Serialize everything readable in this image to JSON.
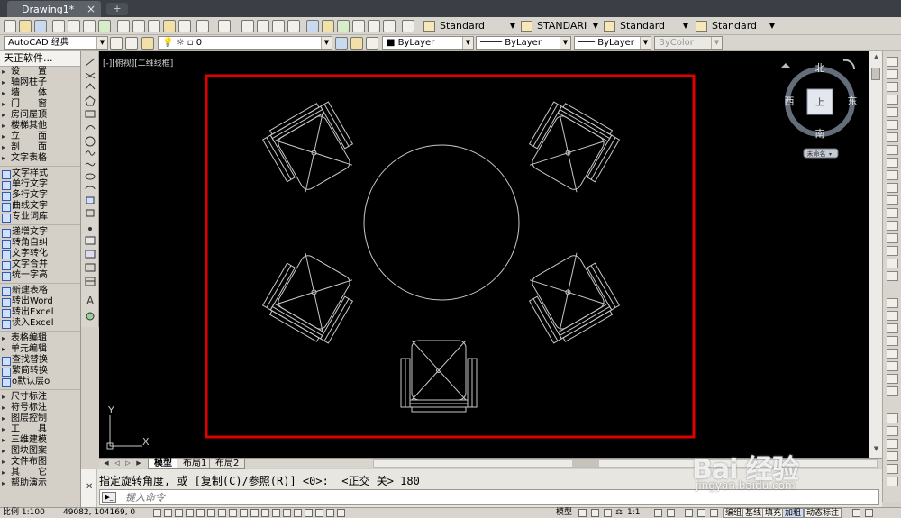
{
  "window": {
    "doc_tab": "Drawing1*",
    "new_tab_icon": "plus-icon"
  },
  "toolbar1": {
    "text_style": "Standard",
    "dim_style": "STANDARI",
    "table_style": "Standard",
    "multileader_style": "Standard"
  },
  "toolbar2": {
    "workspace": "AutoCAD 经典",
    "layer": "0",
    "color": "ByLayer",
    "linetype": "ByLayer",
    "lineweight": "ByLayer",
    "plot_style": "ByColor"
  },
  "palette": {
    "title": "天正软件...",
    "items": [
      {
        "label": "设　　置",
        "kind": "cat"
      },
      {
        "label": "轴网柱子",
        "kind": "cat"
      },
      {
        "label": "墙　　体",
        "kind": "cat"
      },
      {
        "label": "门　　窗",
        "kind": "cat"
      },
      {
        "label": "房间屋顶",
        "kind": "cat"
      },
      {
        "label": "楼梯其他",
        "kind": "cat"
      },
      {
        "label": "立　　面",
        "kind": "cat"
      },
      {
        "label": "剖　　面",
        "kind": "cat"
      },
      {
        "label": "文字表格",
        "kind": "cat"
      },
      {
        "label": "文字样式",
        "kind": "sub"
      },
      {
        "label": "单行文字",
        "kind": "sub"
      },
      {
        "label": "多行文字",
        "kind": "sub"
      },
      {
        "label": "曲线文字",
        "kind": "sub"
      },
      {
        "label": "专业词库",
        "kind": "sub"
      },
      {
        "label": "递增文字",
        "kind": "sub"
      },
      {
        "label": "转角自纠",
        "kind": "sub"
      },
      {
        "label": "文字转化",
        "kind": "sub"
      },
      {
        "label": "文字合并",
        "kind": "sub"
      },
      {
        "label": "统一字高",
        "kind": "sub"
      },
      {
        "label": "新建表格",
        "kind": "sub"
      },
      {
        "label": "转出Word",
        "kind": "sub"
      },
      {
        "label": "转出Excel",
        "kind": "sub"
      },
      {
        "label": "读入Excel",
        "kind": "sub"
      },
      {
        "label": "表格编辑",
        "kind": "cat"
      },
      {
        "label": "单元编辑",
        "kind": "cat"
      },
      {
        "label": "查找替换",
        "kind": "sub"
      },
      {
        "label": "繁简转换",
        "kind": "sub"
      },
      {
        "label": "o默认层o",
        "kind": "sub"
      },
      {
        "label": "尺寸标注",
        "kind": "cat"
      },
      {
        "label": "符号标注",
        "kind": "cat"
      },
      {
        "label": "图层控制",
        "kind": "cat"
      },
      {
        "label": "工　　具",
        "kind": "cat"
      },
      {
        "label": "三维建模",
        "kind": "cat"
      },
      {
        "label": "图块图案",
        "kind": "cat"
      },
      {
        "label": "文件布图",
        "kind": "cat"
      },
      {
        "label": "其　　它",
        "kind": "cat"
      },
      {
        "label": "帮助演示",
        "kind": "cat"
      }
    ]
  },
  "viewport": {
    "label": "[-][俯视][二维线框]",
    "background": "#000000",
    "frame_color": "#e00000",
    "line_color": "#c8c8c8",
    "ucs_x": "X",
    "ucs_y": "Y"
  },
  "viewcube": {
    "north": "北",
    "south": "南",
    "east": "东",
    "west": "西",
    "top_face": "上",
    "wcs": "未命名"
  },
  "layout_tabs": {
    "tabs": [
      "模型",
      "布局1",
      "布局2"
    ],
    "active": 0
  },
  "command": {
    "history": "指定旋转角度, 或 [复制(C)/参照(R)] <0>:  <正交 关> 180",
    "placeholder": "键入命令"
  },
  "status": {
    "scale": "比例 1:100",
    "coords": "49082, 104169, 0",
    "model": "模型",
    "anno_scale": "1:1",
    "toggles": [
      "编组",
      "基线",
      "填充",
      "加粗",
      "动态标注"
    ]
  },
  "watermark": {
    "main": "Bai 经验",
    "sub": "jingyan.baidu.com"
  }
}
